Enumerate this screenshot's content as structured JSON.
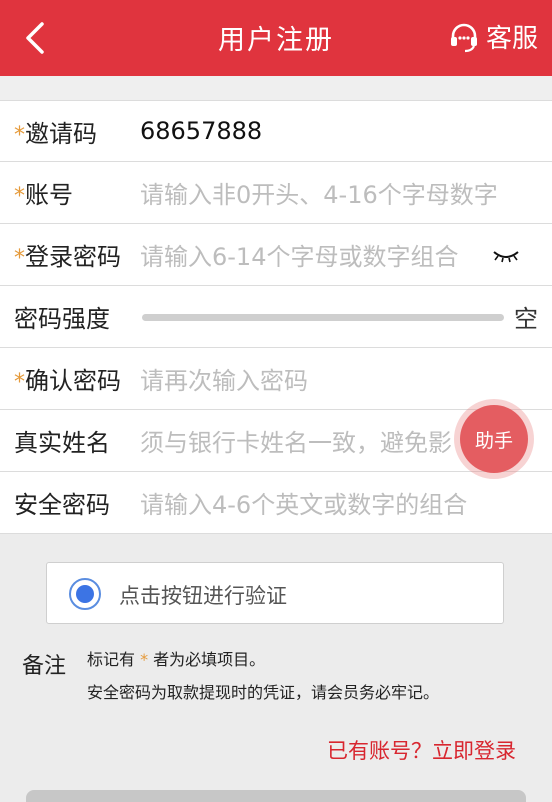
{
  "header": {
    "title": "用户注册",
    "service_label": "客服",
    "back_icon": "chevron-left-icon",
    "service_icon": "headset-icon"
  },
  "form": {
    "invite_code": {
      "label": "邀请码",
      "required": "*",
      "value": "68657888"
    },
    "account": {
      "label": "账号",
      "required": "*",
      "placeholder": "请输入非0开头、4-16个字母数字"
    },
    "password": {
      "label": "登录密码",
      "required": "*",
      "placeholder": "请输入6-14个字母或数字组合",
      "toggle_icon": "eye-closed-icon"
    },
    "strength": {
      "label": "密码强度",
      "level_text": "空",
      "level": 0
    },
    "confirm": {
      "label": "确认密码",
      "required": "*",
      "placeholder": "请再次输入密码"
    },
    "real_name": {
      "label": "真实姓名",
      "placeholder": "须与银行卡姓名一致，避免影"
    },
    "safe_password": {
      "label": "安全密码",
      "placeholder": "请输入4-6个英文或数字的组合"
    }
  },
  "helper": {
    "label": "助手"
  },
  "verify": {
    "label": "点击按钮进行验证"
  },
  "notes": {
    "title": "备注",
    "line1_before": "标记有 ",
    "line1_star": "*",
    "line1_after": " 者为必填项目。",
    "line2": "安全密码为取款提现时的凭证，请会员务必牢记。"
  },
  "login_link": "已有账号？立即登录",
  "colors": {
    "brand": "#e0343e",
    "star": "#e59a3a",
    "link": "#d8262f",
    "radio": "#3c74e4"
  }
}
